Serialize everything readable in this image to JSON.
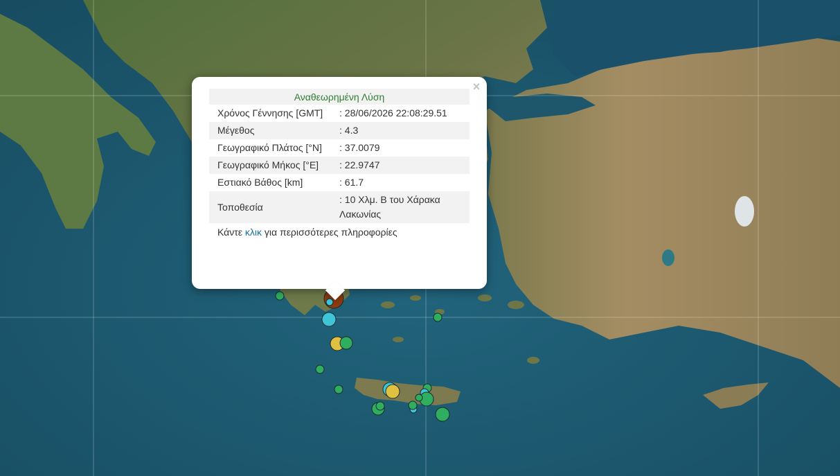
{
  "colors": {
    "sea": "#1d5b73",
    "land_green": "#4f6b3a",
    "land_tan": "#a08a62",
    "heading_green": "#2e7d32",
    "link_blue": "#1a6e9a",
    "marker_green": "#2fae5f",
    "marker_cyan": "#3ec6d8",
    "marker_yellow": "#e0c040",
    "marker_selected": "#8b3a0e"
  },
  "markers": [
    {
      "color": "marker_selected",
      "size": "large",
      "selected": true
    },
    {
      "color": "marker_cyan",
      "size": "small"
    },
    {
      "color": "marker_cyan",
      "size": "medium"
    },
    {
      "color": "marker_yellow",
      "size": "medium"
    },
    {
      "color": "marker_green",
      "size": "medium"
    },
    {
      "color": "marker_green",
      "size": "small"
    },
    {
      "color": "marker_green",
      "size": "small"
    },
    {
      "color": "marker_green",
      "size": "small"
    },
    {
      "color": "marker_green",
      "size": "small"
    },
    {
      "color": "marker_cyan",
      "size": "medium"
    },
    {
      "color": "marker_yellow",
      "size": "medium"
    },
    {
      "color": "marker_green",
      "size": "small"
    },
    {
      "color": "marker_cyan",
      "size": "small"
    },
    {
      "color": "marker_green",
      "size": "medium"
    },
    {
      "color": "marker_green",
      "size": "medium"
    },
    {
      "color": "marker_green",
      "size": "small"
    },
    {
      "color": "marker_cyan",
      "size": "small"
    },
    {
      "color": "marker_green",
      "size": "medium"
    },
    {
      "color": "marker_green",
      "size": "small"
    },
    {
      "color": "marker_green",
      "size": "medium"
    }
  ],
  "popup": {
    "close_symbol": "×",
    "heading": "Αναθεωρημένη Λύση",
    "rows": [
      {
        "label": "Χρόνος Γέννησης [GMT]",
        "value": ": 28/06/2026 22:08:29.51"
      },
      {
        "label": "Μέγεθος",
        "value": ": 4.3"
      },
      {
        "label": "Γεωγραφικό Πλάτος [°N]",
        "value": ": 37.0079"
      },
      {
        "label": "Γεωγραφικό Μήκος [°E]",
        "value": ": 22.9747"
      },
      {
        "label": "Εστιακό Βάθος [km]",
        "value": ": 61.7"
      },
      {
        "label": "Τοποθεσία",
        "value": ": 10 Χλμ. Β του Χάρακα Λακωνίας"
      }
    ],
    "more_prefix": "Κάντε ",
    "more_link": "κλικ",
    "more_suffix": " για περισσότερες πληροφορίες"
  }
}
